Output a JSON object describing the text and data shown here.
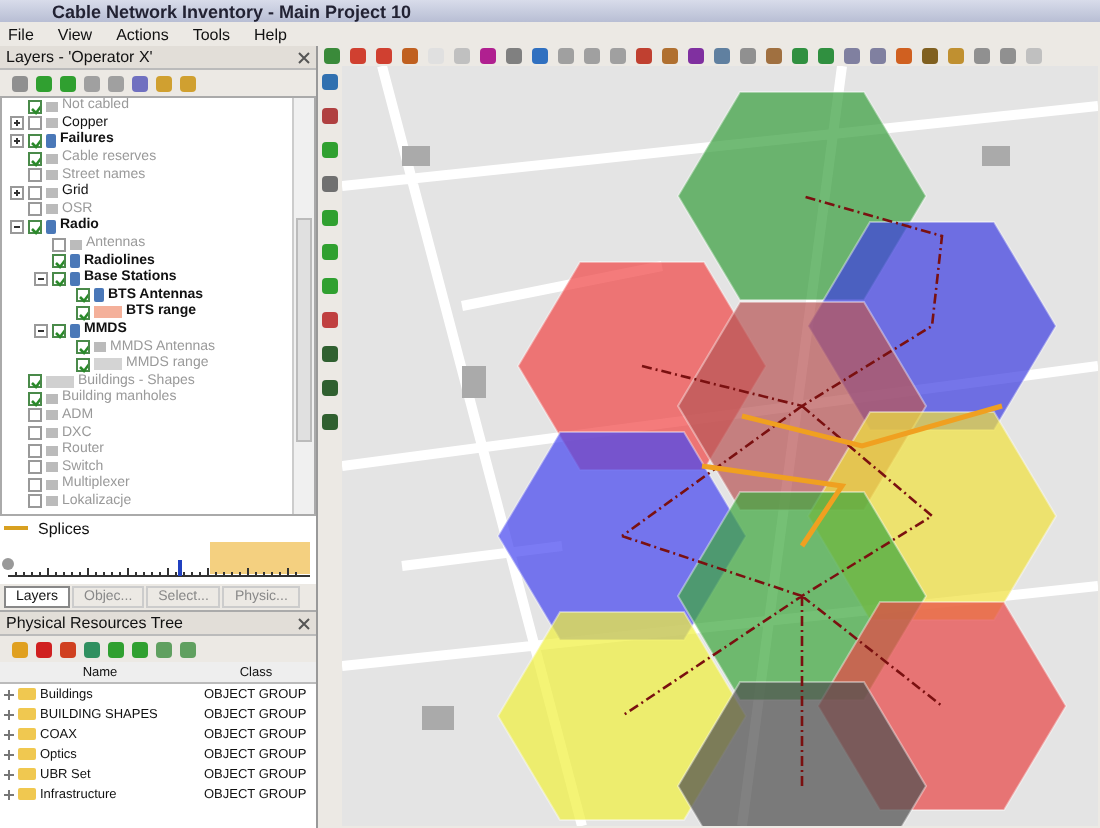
{
  "window": {
    "title": "Cable Network Inventory - Main Project 10"
  },
  "menu": [
    "File",
    "View",
    "Actions",
    "Tools",
    "Help"
  ],
  "layers_panel": {
    "title": "Layers - 'Operator X'",
    "tree": [
      {
        "label": "Not cabled",
        "kind": "layer",
        "checked": true,
        "dimmed": true
      },
      {
        "label": "Copper",
        "kind": "layer",
        "checked": false,
        "dimmed": false,
        "expanded": false
      },
      {
        "label": "Failures",
        "kind": "group",
        "checked": true,
        "dimmed": false,
        "expanded": false
      },
      {
        "label": "Cable reserves",
        "kind": "layer",
        "checked": true,
        "dimmed": true
      },
      {
        "label": "Street names",
        "kind": "layer",
        "checked": false,
        "dimmed": true
      },
      {
        "label": "Grid",
        "kind": "layer",
        "checked": false,
        "dimmed": false,
        "expanded": false
      },
      {
        "label": "OSR",
        "kind": "layer",
        "checked": false,
        "dimmed": true
      },
      {
        "label": "Radio",
        "kind": "group",
        "checked": true,
        "dimmed": false,
        "expanded": true,
        "children": [
          {
            "label": "Antennas",
            "kind": "layer",
            "checked": false,
            "dimmed": true
          },
          {
            "label": "Radiolines",
            "kind": "group",
            "checked": true,
            "dimmed": false
          },
          {
            "label": "Base Stations",
            "kind": "group",
            "checked": true,
            "dimmed": false,
            "expanded": true,
            "children": [
              {
                "label": "BTS Antennas",
                "kind": "group",
                "checked": true,
                "dimmed": false
              },
              {
                "label": "BTS range",
                "kind": "group",
                "checked": true,
                "dimmed": false,
                "color": "#f4b09a"
              }
            ]
          },
          {
            "label": "MMDS",
            "kind": "group",
            "checked": true,
            "dimmed": false,
            "expanded": true,
            "children": [
              {
                "label": "MMDS Antennas",
                "kind": "layer",
                "checked": true,
                "dimmed": true
              },
              {
                "label": "MMDS range",
                "kind": "layer",
                "checked": true,
                "dimmed": true,
                "color": "#d4d4d4"
              }
            ]
          }
        ]
      },
      {
        "label": "Buildings - Shapes",
        "kind": "layer",
        "checked": true,
        "dimmed": true,
        "color": "#d0d0d0"
      },
      {
        "label": "Building manholes",
        "kind": "layer",
        "checked": true,
        "dimmed": true
      },
      {
        "label": "ADM",
        "kind": "layer",
        "checked": false,
        "dimmed": true
      },
      {
        "label": "DXC",
        "kind": "layer",
        "checked": false,
        "dimmed": true
      },
      {
        "label": "Router",
        "kind": "layer",
        "checked": false,
        "dimmed": true
      },
      {
        "label": "Switch",
        "kind": "layer",
        "checked": false,
        "dimmed": true
      },
      {
        "label": "Multiplexer",
        "kind": "layer",
        "checked": false,
        "dimmed": true
      },
      {
        "label": "Lokalizacje",
        "kind": "layer",
        "checked": false,
        "dimmed": true
      }
    ]
  },
  "legend": {
    "label": "Splices"
  },
  "panel_tabs": [
    {
      "label": "Layers",
      "selected": true
    },
    {
      "label": "Objec...",
      "selected": false
    },
    {
      "label": "Select...",
      "selected": false
    },
    {
      "label": "Physic...",
      "selected": false
    }
  ],
  "resources_panel": {
    "title": "Physical Resources Tree",
    "columns": [
      "Name",
      "Class"
    ],
    "rows": [
      {
        "name": "Buildings",
        "class": "OBJECT GROUP"
      },
      {
        "name": "BUILDING SHAPES",
        "class": "OBJECT GROUP"
      },
      {
        "name": "COAX",
        "class": "OBJECT GROUP"
      },
      {
        "name": "Optics",
        "class": "OBJECT GROUP"
      },
      {
        "name": "UBR Set",
        "class": "OBJECT GROUP"
      },
      {
        "name": "Infrastructure",
        "class": "OBJECT GROUP"
      }
    ]
  }
}
